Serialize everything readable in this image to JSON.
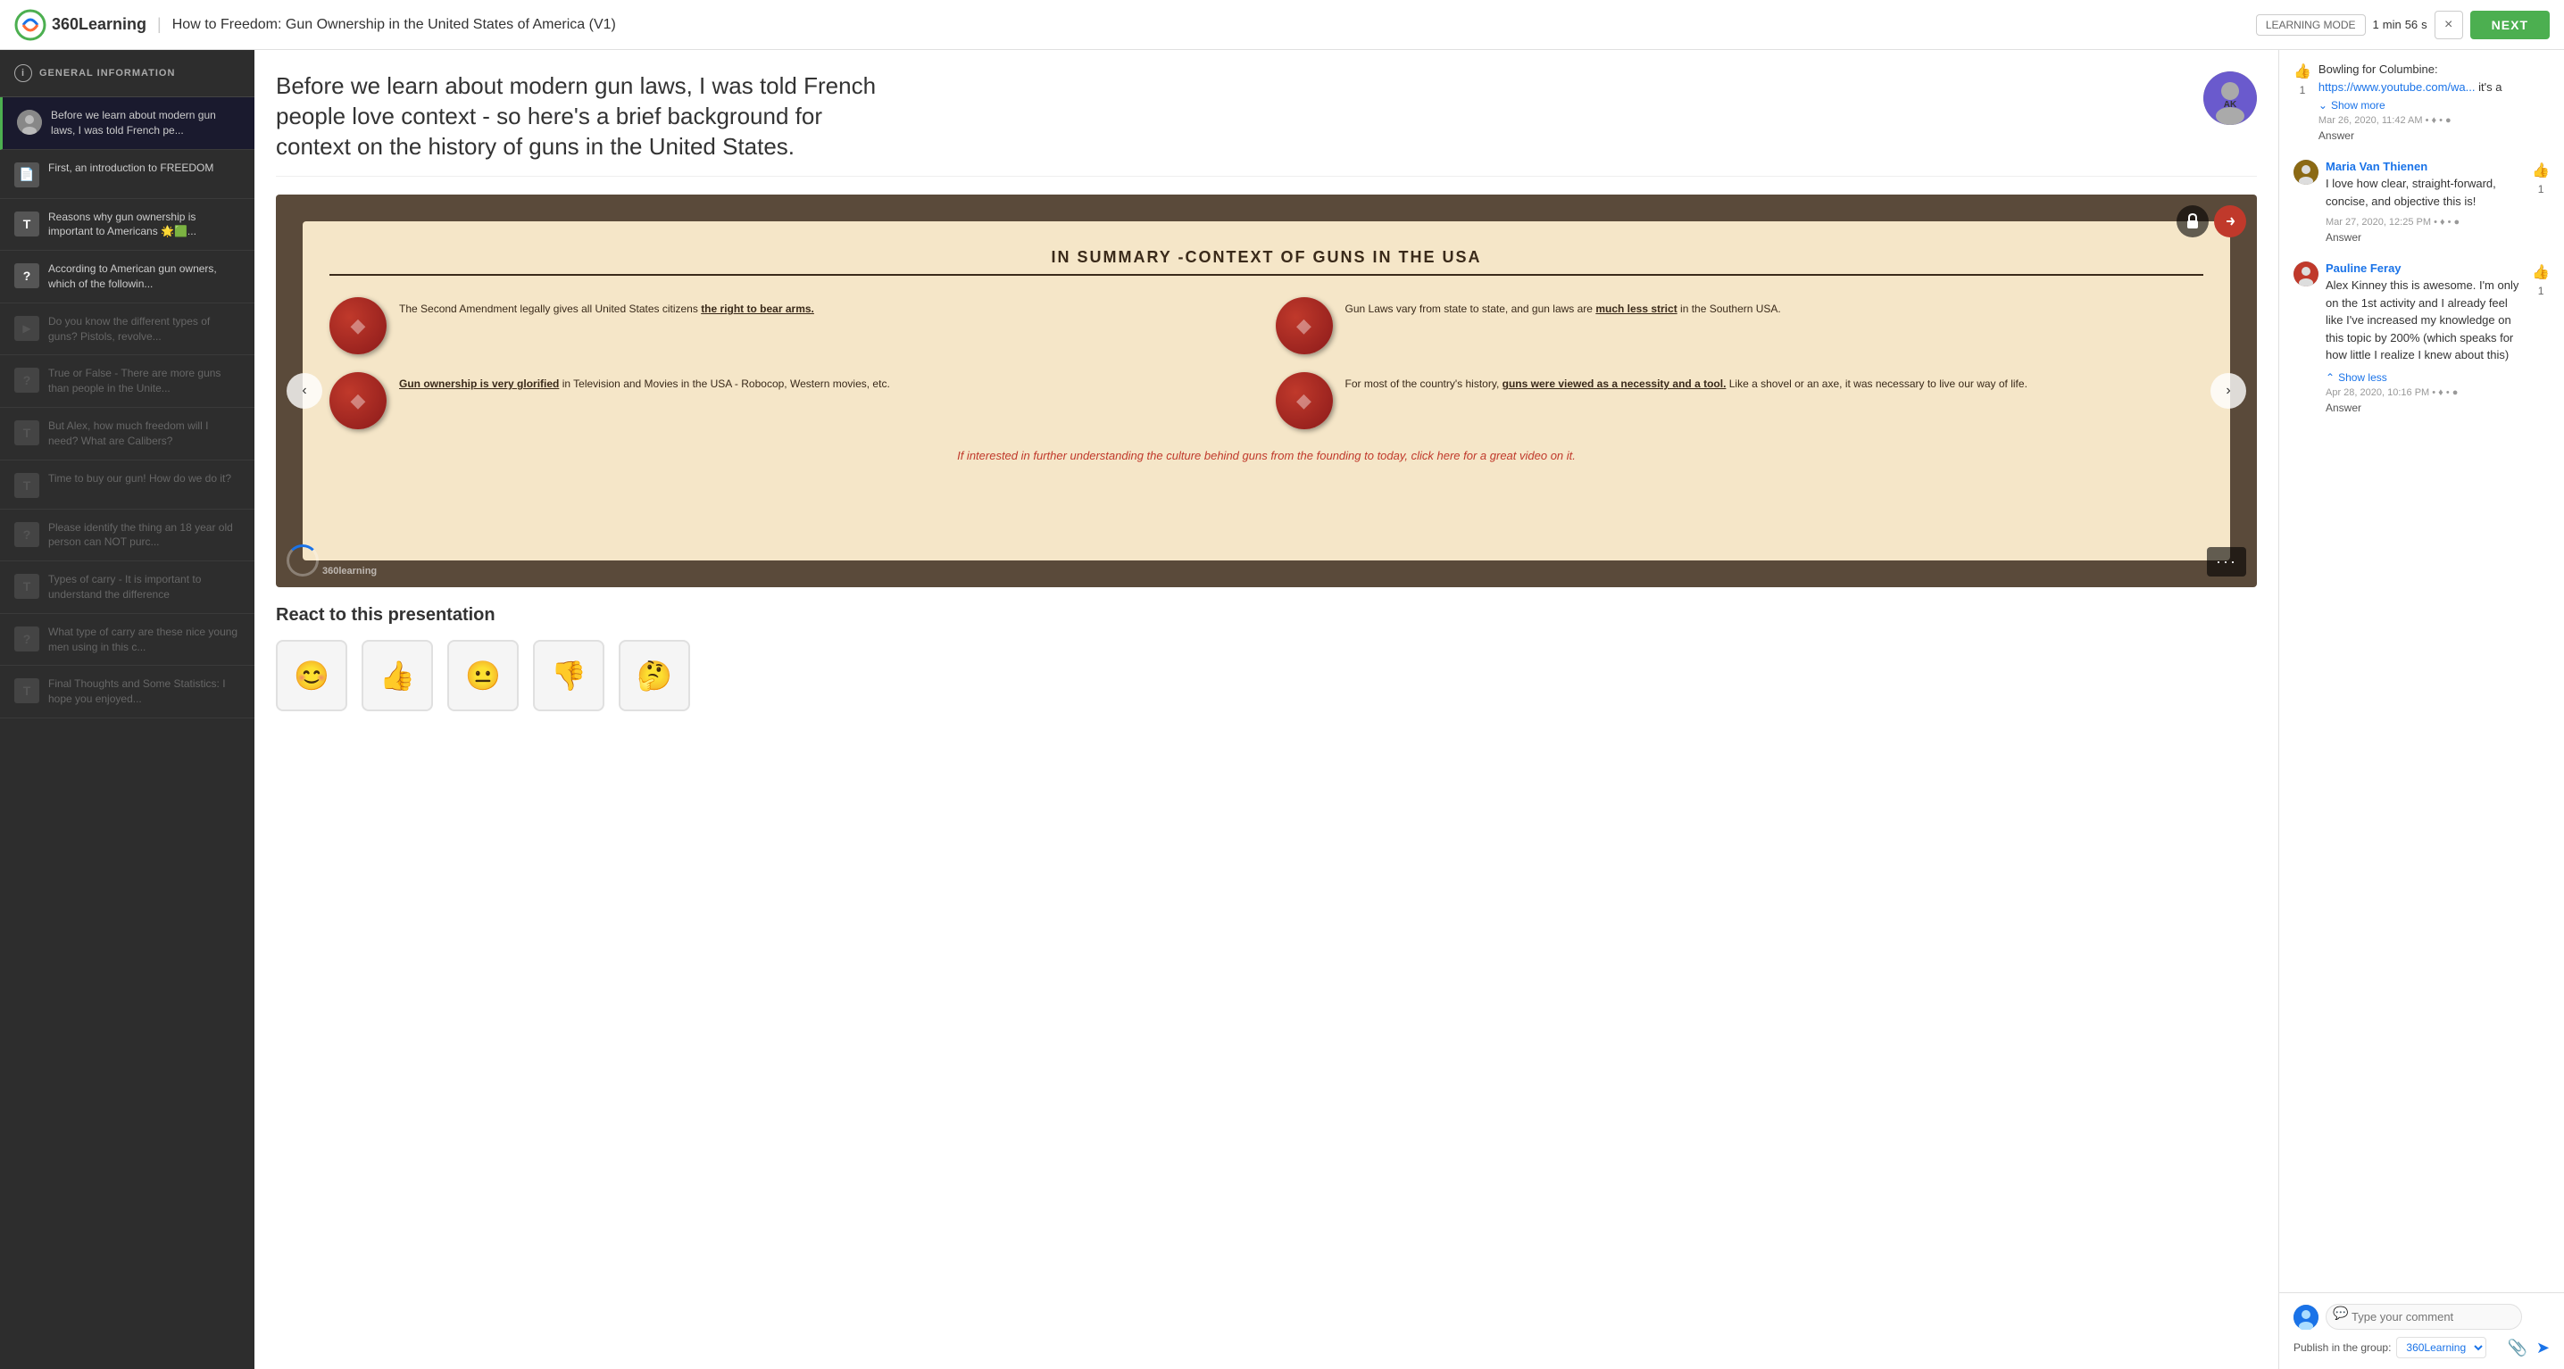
{
  "app": {
    "logo_text": "360Learning",
    "title": "How to Freedom: Gun Ownership in the United States of America (V1)"
  },
  "topbar": {
    "learning_mode_label": "LEARNING MODE",
    "timer_min": "1",
    "timer_sep1": "min",
    "timer_sec": "56",
    "timer_sep2": "s",
    "close_label": "×",
    "next_label": "NEXT"
  },
  "sidebar": {
    "header_label": "GENERAL INFORMATION",
    "items": [
      {
        "id": "item-1",
        "label": "Before we learn about modern gun laws, I was told French pe...",
        "type": "avatar",
        "active": true,
        "disabled": false,
        "icon": "👤"
      },
      {
        "id": "item-2",
        "label": "First, an introduction to FREEDOM",
        "type": "page",
        "active": false,
        "disabled": false,
        "icon": "📄"
      },
      {
        "id": "item-3",
        "label": "Reasons why gun ownership is important to Americans 🌟🟩...",
        "type": "text",
        "active": false,
        "disabled": false,
        "icon": "T"
      },
      {
        "id": "item-4",
        "label": "According to American gun owners, which of the followin...",
        "type": "quiz",
        "active": false,
        "disabled": false,
        "icon": "?"
      },
      {
        "id": "item-5",
        "label": "Do you know the different types of guns? Pistols, revolve...",
        "type": "video",
        "active": false,
        "disabled": true,
        "icon": "▶"
      },
      {
        "id": "item-6",
        "label": "True or False - There are more guns than people in the Unite...",
        "type": "quiz",
        "active": false,
        "disabled": true,
        "icon": "?"
      },
      {
        "id": "item-7",
        "label": "But Alex, how much freedom will I need? What are Calibers?",
        "type": "text",
        "active": false,
        "disabled": true,
        "icon": "T"
      },
      {
        "id": "item-8",
        "label": "Time to buy our gun! How do we do it?",
        "type": "text",
        "active": false,
        "disabled": true,
        "icon": "T"
      },
      {
        "id": "item-9",
        "label": "Please identify the thing an 18 year old person can NOT purc...",
        "type": "quiz",
        "active": false,
        "disabled": true,
        "icon": "?"
      },
      {
        "id": "item-10",
        "label": "Types of carry - It is important to understand the difference",
        "type": "text",
        "active": false,
        "disabled": true,
        "icon": "T"
      },
      {
        "id": "item-11",
        "label": "What type of carry are these nice young men using in this c...",
        "type": "quiz",
        "active": false,
        "disabled": true,
        "icon": "?"
      },
      {
        "id": "item-12",
        "label": "Final Thoughts and Some Statistics: I hope you enjoyed...",
        "type": "text",
        "active": false,
        "disabled": true,
        "icon": "T"
      }
    ]
  },
  "lesson": {
    "title": "Before we learn about modern gun laws, I was told French people love context - so here's a brief background for context on the history of guns in the United States."
  },
  "slide": {
    "inner_title": "IN SUMMARY -CONTEXT OF GUNS IN THE USA",
    "cells": [
      {
        "text_html": "The Second Amendment legally gives all United States citizens <u>the right to bear arms.</u>"
      },
      {
        "text_html": "Gun Laws vary from state to state, and gun laws are <u>much less strict</u> in the Southern USA."
      },
      {
        "text_html": "<u>Gun ownership is very glorified</u> in Television and Movies in the USA - Robocop, Western movies, etc."
      },
      {
        "text_html": "For most of the country's history, <u>guns were viewed as a necessity and a tool.</u> Like a shovel or an axe, it was necessary to live our way of life."
      }
    ],
    "italic_text": "If interested in further understanding the culture behind guns from the founding to today, click here for a great video on it.",
    "loading_text": "360learning"
  },
  "react": {
    "title": "React to this presentation",
    "emojis": [
      "😊",
      "👍",
      "😐",
      "👎",
      "🤔"
    ]
  },
  "comments": [
    {
      "id": "comment-bowling",
      "body_prefix": "Bowling for Columbine: ",
      "link_text": "https://www.youtube.com/wa...",
      "body_suffix": " it's a",
      "show_toggle": "Show more",
      "show_toggle_type": "more",
      "meta": "Mar 26, 2020, 11:42 AM • ♦ • ●",
      "action": "Answer",
      "likes": "1"
    },
    {
      "id": "comment-maria",
      "author": "Maria Van Thienen",
      "body": "I love how clear, straight-forward, concise, and objective this is!",
      "meta": "Mar 27, 2020, 12:25 PM • ♦ • ●",
      "action": "Answer",
      "likes": "1"
    },
    {
      "id": "comment-pauline",
      "author": "Pauline Feray",
      "body": "Alex Kinney this is awesome. I'm only on the 1st activity and I already feel like I've increased my knowledge on this topic by 200% (which speaks for how little I realize I knew about this)",
      "show_toggle": "Show less",
      "show_toggle_type": "less",
      "meta": "Apr 28, 2020, 10:16 PM • ♦ • ●",
      "action": "Answer",
      "likes": "1"
    }
  ],
  "comment_input": {
    "placeholder": "Type your comment",
    "publish_label": "Publish in the group:",
    "group_name": "360Learning",
    "chevron": "▾"
  }
}
